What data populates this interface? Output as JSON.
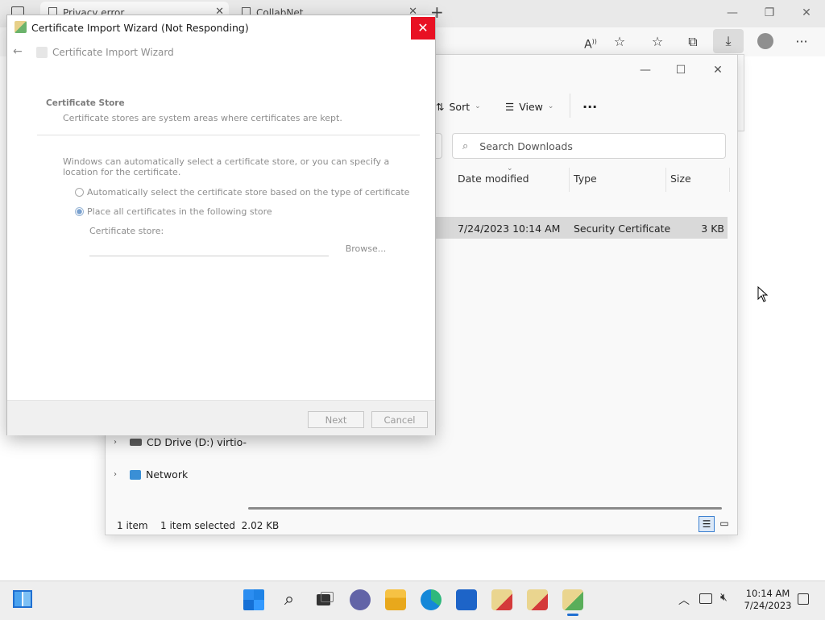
{
  "browser": {
    "tabs": [
      {
        "label": "Privacy error"
      },
      {
        "label": "CollabNet"
      }
    ],
    "new_tab_symbol": "+"
  },
  "explorer": {
    "commands": {
      "sort_label": "Sort",
      "view_label": "View",
      "more_label": "···"
    },
    "search_placeholder": "Search Downloads",
    "columns": {
      "date": "Date modified",
      "type": "Type",
      "size": "Size"
    },
    "file": {
      "date": "7/24/2023 10:14 AM",
      "type": "Security Certificate",
      "size": "3 KB"
    },
    "tree": [
      {
        "label": "CD Drive (D:) virtio-"
      },
      {
        "label": "Network"
      }
    ],
    "status": {
      "count": "1 item",
      "selection": "1 item selected  2.02 KB"
    }
  },
  "wizard": {
    "window_title": "Certificate Import Wizard (Not Responding)",
    "header_title": "Certificate Import Wizard",
    "section_title": "Certificate Store",
    "section_desc": "Certificate stores are system areas where certificates are kept.",
    "intro": "Windows can automatically select a certificate store, or you can specify a location for the certificate.",
    "option_auto": "Automatically select the certificate store based on the type of certificate",
    "option_place": "Place all certificates in the following store",
    "store_label": "Certificate store:",
    "browse_label": "Browse...",
    "next_label": "Next",
    "cancel_label": "Cancel"
  },
  "taskbar": {
    "time": "10:14 AM",
    "date": "7/24/2023"
  },
  "colors": {
    "close_red": "#e81123",
    "selected_row": "#d9d9d9",
    "taskbar_bg": "#eeeeee"
  }
}
